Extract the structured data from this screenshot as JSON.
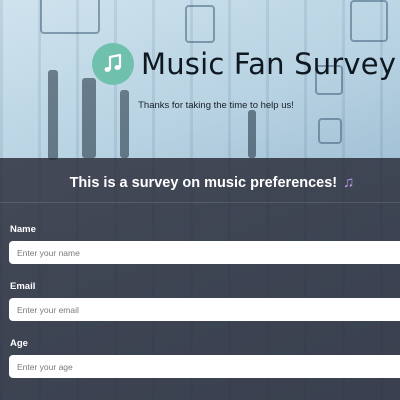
{
  "header": {
    "logo_icon": "music-note-icon",
    "title": "Music Fan Survey",
    "subtitle": "Thanks for taking the time to help us!"
  },
  "form": {
    "heading": "This is a survey on music preferences!",
    "heading_icon": "music-notes-icon",
    "fields": [
      {
        "label": "Name",
        "placeholder": "Enter your name"
      },
      {
        "label": "Email",
        "placeholder": "Enter your email"
      },
      {
        "label": "Age",
        "placeholder": "Enter your age"
      }
    ]
  },
  "colors": {
    "logo_circle": "#6fc0ad",
    "panel_bg": "rgba(38,38,50,0.80)",
    "note_accent": "#b79be6"
  }
}
